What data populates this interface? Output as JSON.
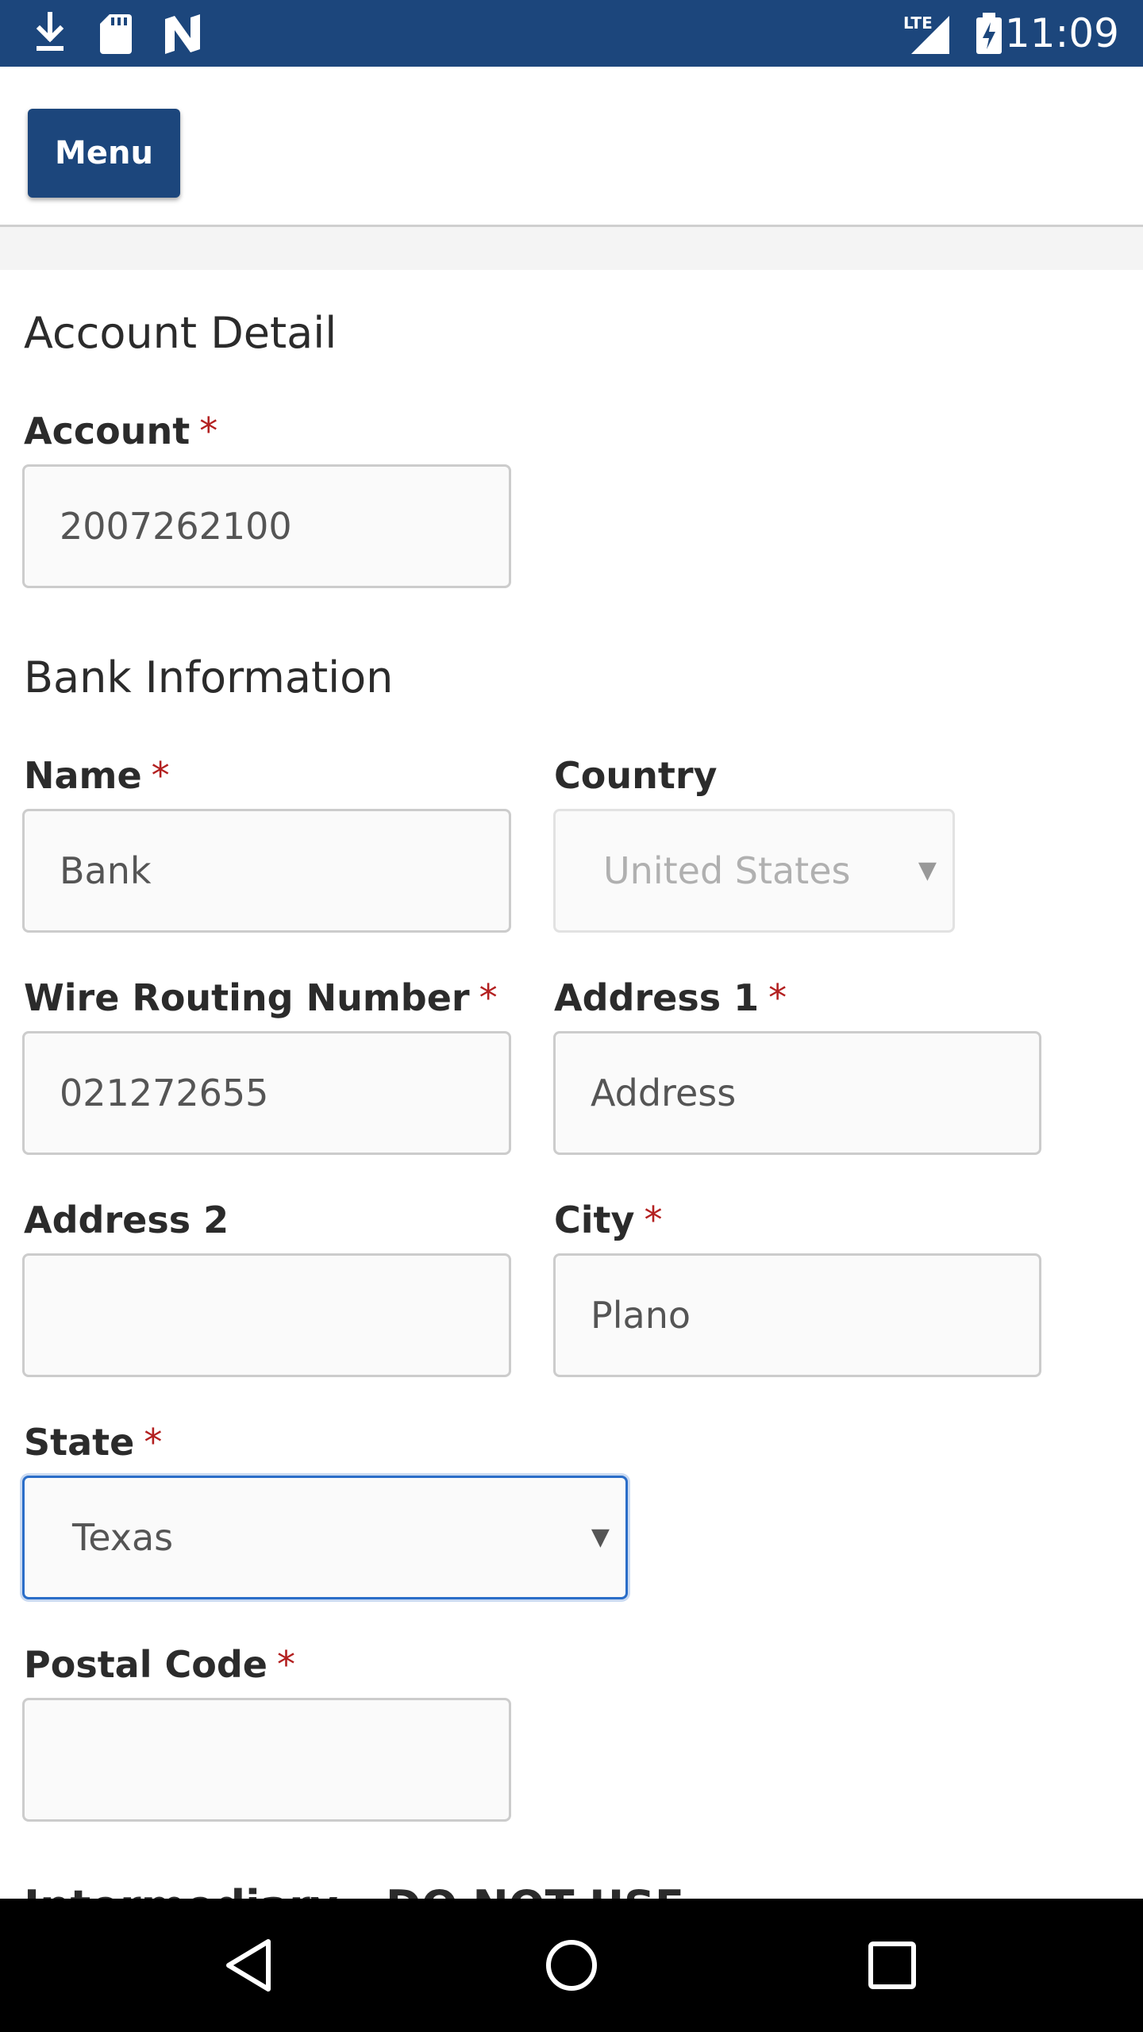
{
  "status_bar": {
    "time": "11:09",
    "left_icons": [
      "download-icon",
      "sd-card-icon",
      "n-logo-icon"
    ],
    "right_icons": [
      "lte-signal-icon",
      "battery-charging-icon"
    ],
    "network_label": "LTE"
  },
  "header": {
    "menu_label": "Menu"
  },
  "account_detail": {
    "title": "Account Detail",
    "account_label": "Account",
    "account_value": "2007262100"
  },
  "bank_information": {
    "title": "Bank Information",
    "name_label": "Name",
    "name_value": "Bank",
    "country_label": "Country",
    "country_value": "United States",
    "routing_label": "Wire Routing Number",
    "routing_value": "021272655",
    "address1_label": "Address 1",
    "address1_value": "Address",
    "address2_label": "Address 2",
    "address2_value": "",
    "city_label": "City",
    "city_value": "Plano",
    "state_label": "State",
    "state_value": "Texas",
    "postal_label": "Postal Code",
    "postal_value": ""
  },
  "required_marker": "*",
  "next_section_partial": "Intermediary - DO NOT USE",
  "colors": {
    "brand_blue": "#1c467c",
    "required_red": "#b32020",
    "focus_blue": "#2a6dc8"
  },
  "nav_bar": {
    "icons": [
      "back-icon",
      "home-icon",
      "recents-icon"
    ]
  }
}
